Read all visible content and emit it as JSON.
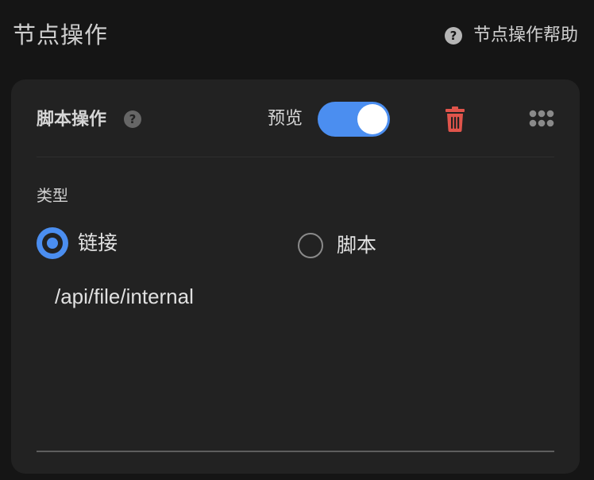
{
  "header": {
    "title": "节点操作",
    "help_icon": "question-circle-icon",
    "help_label": "节点操作帮助"
  },
  "card": {
    "title": "脚本操作",
    "title_help_icon": "question-circle-icon",
    "preview_label": "预览",
    "preview_enabled": true,
    "delete_icon": "trash-icon",
    "drag_icon": "grip-dots-icon",
    "type_label": "类型",
    "options": [
      {
        "label": "链接",
        "selected": true
      },
      {
        "label": "脚本",
        "selected": false
      }
    ],
    "value": "/api/file/internal"
  },
  "colors": {
    "accent": "#4b8ef0",
    "danger": "#e0544b",
    "background": "#151515",
    "card": "#222222"
  }
}
